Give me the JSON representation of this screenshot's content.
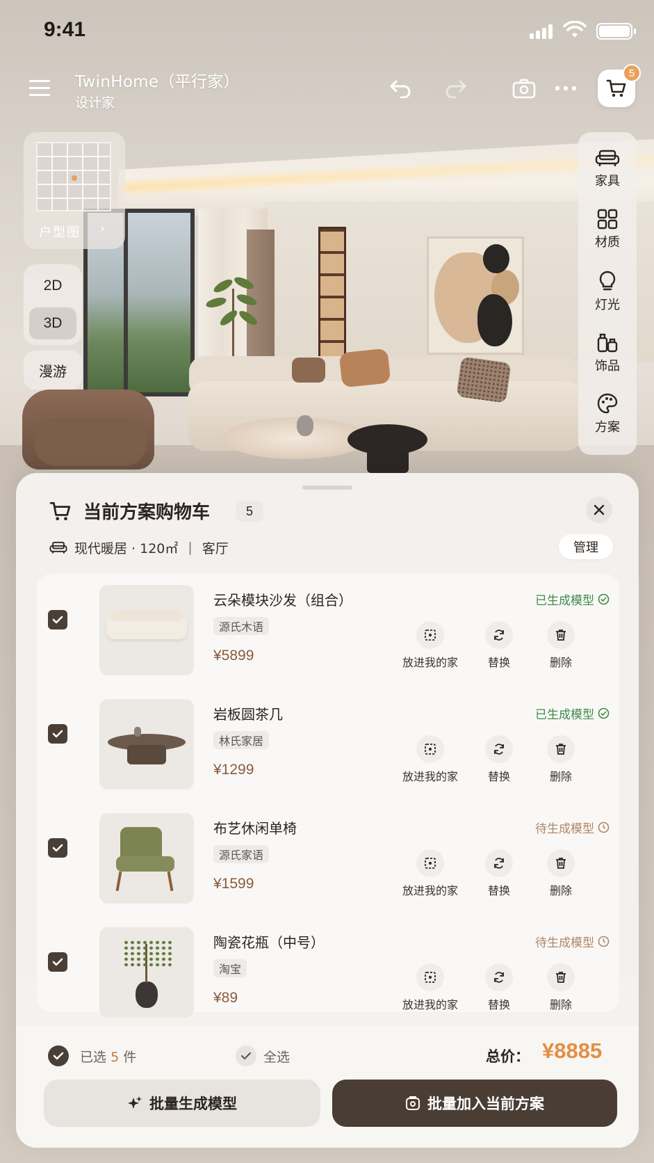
{
  "status_bar": {
    "time": "9:41"
  },
  "header": {
    "title": "TwinHome（平行家）",
    "subtitle": "设计家",
    "cart_badge": "5"
  },
  "left_panel": {
    "floorplan_label": "户型图",
    "views": [
      "2D",
      "3D"
    ],
    "active_view": "3D",
    "roam_label": "漫游"
  },
  "right_toolbar": {
    "items": [
      {
        "label": "家具",
        "icon": "sofa-icon"
      },
      {
        "label": "材质",
        "icon": "grid-icon"
      },
      {
        "label": "灯光",
        "icon": "bulb-icon"
      },
      {
        "label": "饰品",
        "icon": "decor-icon"
      },
      {
        "label": "方案",
        "icon": "palette-icon"
      }
    ]
  },
  "cart_sheet": {
    "title": "当前方案购物车",
    "count": "5",
    "scheme_name": "现代暖居 · 120㎡",
    "room": "客厅",
    "manage_label": "管理",
    "actions": {
      "place": "放进我的家",
      "replace": "替换",
      "delete": "删除"
    },
    "items": [
      {
        "name": "云朵模块沙发（组合）",
        "brand": "源氏木语",
        "price": "¥5899",
        "status": "已生成模型",
        "status_type": "done",
        "checked": true
      },
      {
        "name": "岩板圆茶几",
        "brand": "林氏家居",
        "price": "¥1299",
        "status": "已生成模型",
        "status_type": "done",
        "checked": true
      },
      {
        "name": "布艺休闲单椅",
        "brand": "源氏家语",
        "price": "¥1599",
        "status": "待生成模型",
        "status_type": "pending",
        "checked": true
      },
      {
        "name": "陶瓷花瓶（中号）",
        "brand": "淘宝",
        "price": "¥89",
        "status": "待生成模型",
        "status_type": "pending",
        "checked": true
      }
    ],
    "footer": {
      "selected_prefix": "已选",
      "selected_count": "5",
      "selected_suffix": "件",
      "select_all": "全选",
      "total_label": "总价：",
      "total_value": "¥8885",
      "batch_generate": "批量生成模型",
      "batch_add": "批量加入当前方案"
    }
  },
  "colors": {
    "accent_orange": "#e38f43",
    "dark_brown": "#4a3d34",
    "done_green": "#3f8a4c",
    "pending_brown": "#b08666"
  }
}
